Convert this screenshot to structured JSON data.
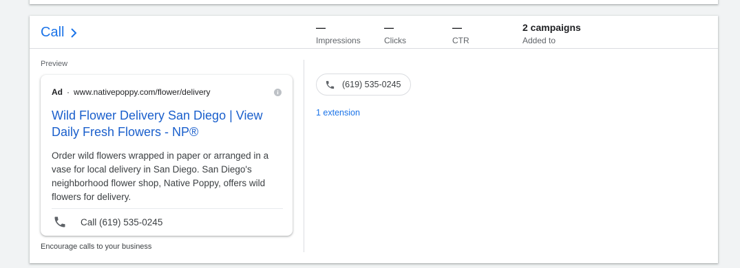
{
  "header": {
    "title": "Call",
    "metrics": [
      {
        "value": "—",
        "label": "Impressions"
      },
      {
        "value": "—",
        "label": "Clicks"
      },
      {
        "value": "—",
        "label": "CTR"
      },
      {
        "value": "2 campaigns",
        "label": "Added to"
      }
    ]
  },
  "preview": {
    "label": "Preview",
    "ad": {
      "badge": "Ad",
      "separator": "·",
      "url": "www.nativepoppy.com/flower/delivery",
      "headline": "Wild Flower Delivery San Diego | View Daily Fresh Flowers - NP®",
      "description": "Order wild flowers wrapped in paper or arranged in a vase for local delivery in San Diego. San Diego's neighborhood flower shop, Native Poppy, offers wild flowers for delivery.",
      "call_text": "Call (619) 535-0245"
    },
    "footnote": "Encourage calls to your business"
  },
  "extension": {
    "phone": "(619) 535-0245",
    "count_link": "1 extension"
  },
  "colors": {
    "link": "#1a73e8",
    "divider": "#dadce0",
    "background": "#f1f3f4"
  },
  "icons": {
    "title_chevron": "chevron-right-icon",
    "info": "info-icon",
    "phone": "phone-icon"
  }
}
